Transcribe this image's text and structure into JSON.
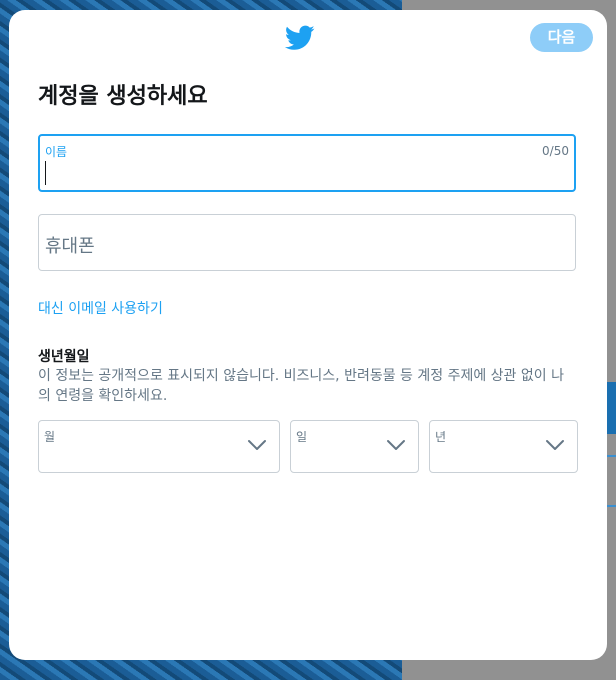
{
  "header": {
    "logo_icon": "twitter-bird-icon",
    "next_label": "다음"
  },
  "title": "계정을 생성하세요",
  "name_field": {
    "label": "이름",
    "counter": "0/50",
    "value": ""
  },
  "phone_field": {
    "placeholder": "휴대폰"
  },
  "email_link": "대신 이메일 사용하기",
  "dob": {
    "title": "생년월일",
    "description": "이 정보는 공개적으로 표시되지 않습니다. 비즈니스, 반려동물 등 계정 주제에 상관 없이 나의 연령을 확인하세요.",
    "month_label": "월",
    "day_label": "일",
    "year_label": "년"
  },
  "colors": {
    "accent": "#1da1f2",
    "next_button": "#8ecdf8",
    "text_primary": "#14171a",
    "text_secondary": "#657786"
  }
}
